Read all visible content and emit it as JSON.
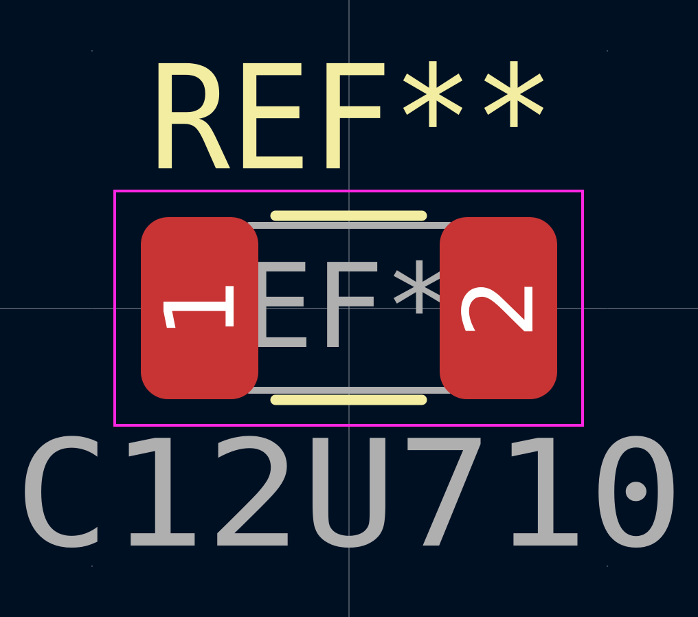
{
  "footprint": {
    "reference": "REF**",
    "value": "C12U710",
    "fab_reference": "EF*",
    "pads": [
      {
        "number": "1"
      },
      {
        "number": "2"
      }
    ]
  },
  "colors": {
    "background": "#001023",
    "silkscreen": "#F2EDA1",
    "courtyard": "#FF26E2",
    "fabrication": "#AFAFAF",
    "pad_copper": "#C83434",
    "pad_number": "#FFFFFF",
    "crosshair": "#C8C8C8"
  }
}
